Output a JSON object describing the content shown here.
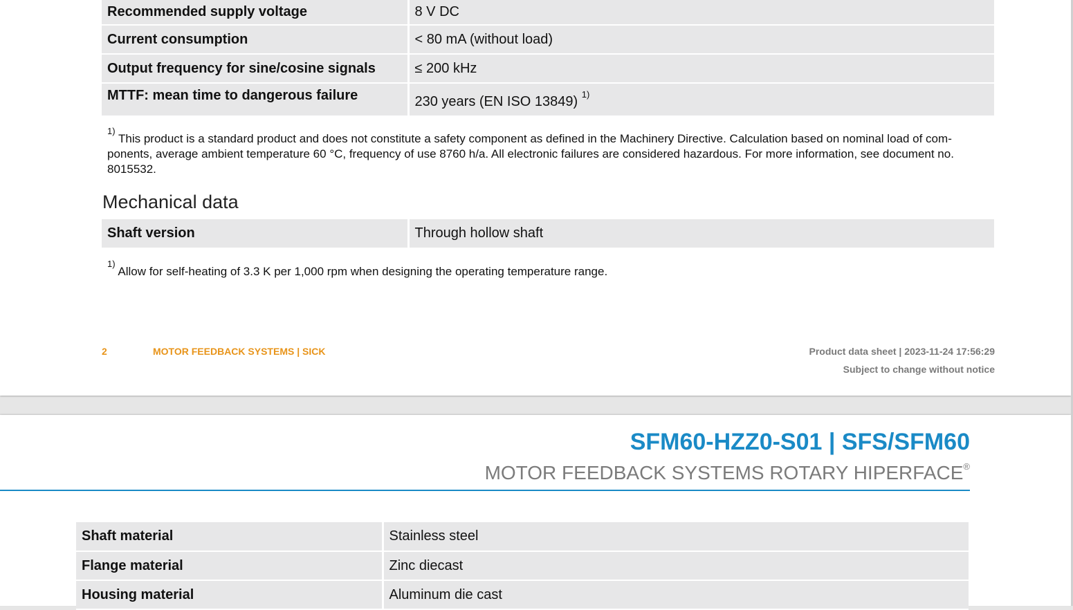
{
  "electrical_rows": [
    {
      "label": "Recommended supply voltage",
      "value": "8 V DC",
      "note": ""
    },
    {
      "label": "Current consumption",
      "value": "< 80 mA (without load)",
      "note": ""
    },
    {
      "label": "Output frequency for sine/cosine signals",
      "value": "≤ 200 kHz",
      "note": ""
    },
    {
      "label": "MTTF: mean time to dangerous failure",
      "value": "230 years (EN ISO 13849)",
      "note": "1)"
    }
  ],
  "footnote_mttf": {
    "marker": "1)",
    "text": "This product is a standard product and does not constitute a safety component as defined in the Machinery Directive. Calculation based on nominal load of com­ponents, average ambient temperature 60 °C, frequency of use 8760 h/a. All electronic failures are considered hazardous. For more information, see document no. 8015532."
  },
  "mechanical_heading": "Mechanical data",
  "mechanical_rows_page1": [
    {
      "label": "Shaft version",
      "value": "Through hollow shaft"
    }
  ],
  "footnote_heating": {
    "marker": "1)",
    "text": "Allow for self-heating of 3.3 K per 1,000 rpm when designing the operating temperature range."
  },
  "footer": {
    "page_number": "2",
    "brand": "MOTOR FEEDBACK SYSTEMS | SICK",
    "doc_type": "Product data sheet | 2023-11-24 17:56:29",
    "notice": "Subject to change without notice"
  },
  "header_page2": {
    "title": "SFM60-HZZ0-S01 | SFS/SFM60",
    "subtitle": "MOTOR FEEDBACK SYSTEMS ROTARY HIPERFACE",
    "registered": "®"
  },
  "mechanical_rows_page2": [
    {
      "label": "Shaft material",
      "value": "Stainless steel"
    },
    {
      "label": "Flange material",
      "value": "Zinc diecast"
    },
    {
      "label": "Housing material",
      "value": "Aluminum die cast"
    }
  ],
  "colors": {
    "accent_orange": "#e8941a",
    "title_blue": "#1a8ac6",
    "row_gray": "#e7e7e8"
  }
}
